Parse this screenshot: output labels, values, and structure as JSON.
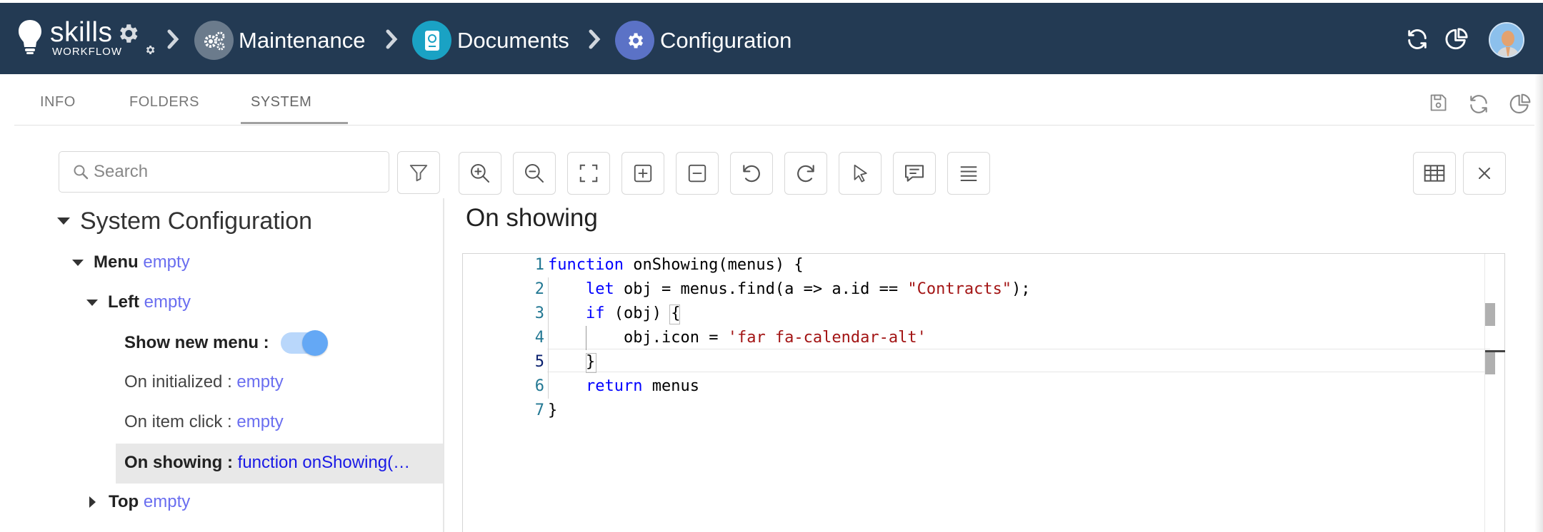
{
  "header": {
    "brand": {
      "name": "skills",
      "sub": "WORKFLOW"
    },
    "breadcrumbs": [
      {
        "label": "Maintenance",
        "icon": "gears-icon",
        "color": "#6b7b8c"
      },
      {
        "label": "Documents",
        "icon": "passport-icon",
        "color": "#1aa2c4"
      },
      {
        "label": "Configuration",
        "icon": "gear-icon",
        "color": "#5b72c6"
      }
    ],
    "actions": [
      "refresh-icon",
      "chart-pie-icon"
    ],
    "avatar": "user-avatar"
  },
  "tabs": {
    "items": [
      "INFO",
      "FOLDERS",
      "SYSTEM"
    ],
    "active": "SYSTEM"
  },
  "search": {
    "placeholder": "Search"
  },
  "tree": {
    "root": "System Configuration",
    "menu": {
      "label": "Menu",
      "value": "empty"
    },
    "left": {
      "label": "Left",
      "value": "empty"
    },
    "show_new_menu": {
      "label": "Show new menu :",
      "value": true
    },
    "on_initialized": {
      "label": "On initialized :",
      "value": "empty"
    },
    "on_item_click": {
      "label": "On item click :",
      "value": "empty"
    },
    "on_showing": {
      "label": "On showing :",
      "value": "function onShowing(…"
    },
    "top": {
      "label": "Top",
      "value": "empty"
    }
  },
  "toolbar": [
    "zoom-in-icon",
    "zoom-out-icon",
    "fit-screen-icon",
    "expand-all-icon",
    "collapse-all-icon",
    "undo-icon",
    "redo-icon",
    "pointer-icon",
    "comment-icon",
    "list-icon",
    "table-icon",
    "close-icon"
  ],
  "editor": {
    "title": "On showing",
    "line_numbers": [
      "1",
      "2",
      "3",
      "4",
      "5",
      "6",
      "7"
    ],
    "active_line": 5,
    "code": {
      "l1_kw": "function",
      "l1_rest": " onShowing(menus) {",
      "l2_kw": "let",
      "l2_mid": " obj = menus.find(a => a.id == ",
      "l2_str": "\"Contracts\"",
      "l2_end": ");",
      "l3_kw": "if",
      "l3_rest": " (obj) ",
      "l3_brace": "{",
      "l4_pre": "obj.icon = ",
      "l4_str": "'far fa-calendar-alt'",
      "l5_brace": "}",
      "l6_kw": "return",
      "l6_rest": " menus",
      "l7": "}"
    }
  }
}
